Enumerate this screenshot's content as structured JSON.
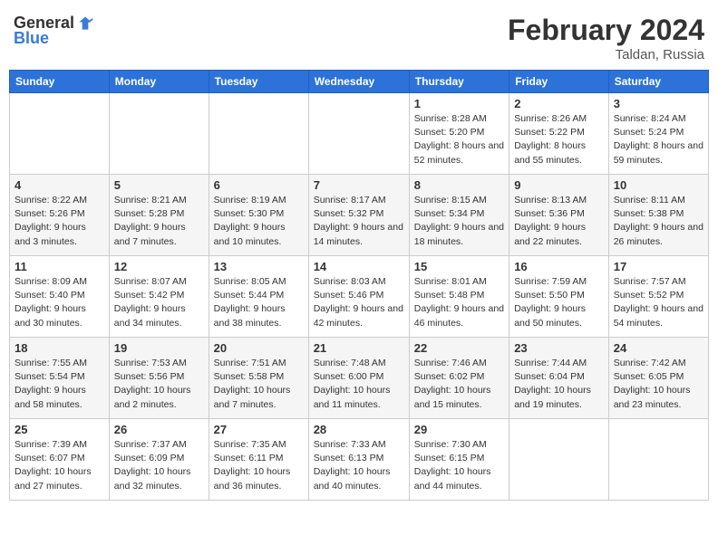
{
  "header": {
    "logo_general": "General",
    "logo_blue": "Blue",
    "month_year": "February 2024",
    "location": "Taldan, Russia"
  },
  "days_of_week": [
    "Sunday",
    "Monday",
    "Tuesday",
    "Wednesday",
    "Thursday",
    "Friday",
    "Saturday"
  ],
  "weeks": [
    [
      {
        "day": "",
        "sunrise": "",
        "sunset": "",
        "daylight": ""
      },
      {
        "day": "",
        "sunrise": "",
        "sunset": "",
        "daylight": ""
      },
      {
        "day": "",
        "sunrise": "",
        "sunset": "",
        "daylight": ""
      },
      {
        "day": "",
        "sunrise": "",
        "sunset": "",
        "daylight": ""
      },
      {
        "day": "1",
        "sunrise": "Sunrise: 8:28 AM",
        "sunset": "Sunset: 5:20 PM",
        "daylight": "Daylight: 8 hours and 52 minutes."
      },
      {
        "day": "2",
        "sunrise": "Sunrise: 8:26 AM",
        "sunset": "Sunset: 5:22 PM",
        "daylight": "Daylight: 8 hours and 55 minutes."
      },
      {
        "day": "3",
        "sunrise": "Sunrise: 8:24 AM",
        "sunset": "Sunset: 5:24 PM",
        "daylight": "Daylight: 8 hours and 59 minutes."
      }
    ],
    [
      {
        "day": "4",
        "sunrise": "Sunrise: 8:22 AM",
        "sunset": "Sunset: 5:26 PM",
        "daylight": "Daylight: 9 hours and 3 minutes."
      },
      {
        "day": "5",
        "sunrise": "Sunrise: 8:21 AM",
        "sunset": "Sunset: 5:28 PM",
        "daylight": "Daylight: 9 hours and 7 minutes."
      },
      {
        "day": "6",
        "sunrise": "Sunrise: 8:19 AM",
        "sunset": "Sunset: 5:30 PM",
        "daylight": "Daylight: 9 hours and 10 minutes."
      },
      {
        "day": "7",
        "sunrise": "Sunrise: 8:17 AM",
        "sunset": "Sunset: 5:32 PM",
        "daylight": "Daylight: 9 hours and 14 minutes."
      },
      {
        "day": "8",
        "sunrise": "Sunrise: 8:15 AM",
        "sunset": "Sunset: 5:34 PM",
        "daylight": "Daylight: 9 hours and 18 minutes."
      },
      {
        "day": "9",
        "sunrise": "Sunrise: 8:13 AM",
        "sunset": "Sunset: 5:36 PM",
        "daylight": "Daylight: 9 hours and 22 minutes."
      },
      {
        "day": "10",
        "sunrise": "Sunrise: 8:11 AM",
        "sunset": "Sunset: 5:38 PM",
        "daylight": "Daylight: 9 hours and 26 minutes."
      }
    ],
    [
      {
        "day": "11",
        "sunrise": "Sunrise: 8:09 AM",
        "sunset": "Sunset: 5:40 PM",
        "daylight": "Daylight: 9 hours and 30 minutes."
      },
      {
        "day": "12",
        "sunrise": "Sunrise: 8:07 AM",
        "sunset": "Sunset: 5:42 PM",
        "daylight": "Daylight: 9 hours and 34 minutes."
      },
      {
        "day": "13",
        "sunrise": "Sunrise: 8:05 AM",
        "sunset": "Sunset: 5:44 PM",
        "daylight": "Daylight: 9 hours and 38 minutes."
      },
      {
        "day": "14",
        "sunrise": "Sunrise: 8:03 AM",
        "sunset": "Sunset: 5:46 PM",
        "daylight": "Daylight: 9 hours and 42 minutes."
      },
      {
        "day": "15",
        "sunrise": "Sunrise: 8:01 AM",
        "sunset": "Sunset: 5:48 PM",
        "daylight": "Daylight: 9 hours and 46 minutes."
      },
      {
        "day": "16",
        "sunrise": "Sunrise: 7:59 AM",
        "sunset": "Sunset: 5:50 PM",
        "daylight": "Daylight: 9 hours and 50 minutes."
      },
      {
        "day": "17",
        "sunrise": "Sunrise: 7:57 AM",
        "sunset": "Sunset: 5:52 PM",
        "daylight": "Daylight: 9 hours and 54 minutes."
      }
    ],
    [
      {
        "day": "18",
        "sunrise": "Sunrise: 7:55 AM",
        "sunset": "Sunset: 5:54 PM",
        "daylight": "Daylight: 9 hours and 58 minutes."
      },
      {
        "day": "19",
        "sunrise": "Sunrise: 7:53 AM",
        "sunset": "Sunset: 5:56 PM",
        "daylight": "Daylight: 10 hours and 2 minutes."
      },
      {
        "day": "20",
        "sunrise": "Sunrise: 7:51 AM",
        "sunset": "Sunset: 5:58 PM",
        "daylight": "Daylight: 10 hours and 7 minutes."
      },
      {
        "day": "21",
        "sunrise": "Sunrise: 7:48 AM",
        "sunset": "Sunset: 6:00 PM",
        "daylight": "Daylight: 10 hours and 11 minutes."
      },
      {
        "day": "22",
        "sunrise": "Sunrise: 7:46 AM",
        "sunset": "Sunset: 6:02 PM",
        "daylight": "Daylight: 10 hours and 15 minutes."
      },
      {
        "day": "23",
        "sunrise": "Sunrise: 7:44 AM",
        "sunset": "Sunset: 6:04 PM",
        "daylight": "Daylight: 10 hours and 19 minutes."
      },
      {
        "day": "24",
        "sunrise": "Sunrise: 7:42 AM",
        "sunset": "Sunset: 6:05 PM",
        "daylight": "Daylight: 10 hours and 23 minutes."
      }
    ],
    [
      {
        "day": "25",
        "sunrise": "Sunrise: 7:39 AM",
        "sunset": "Sunset: 6:07 PM",
        "daylight": "Daylight: 10 hours and 27 minutes."
      },
      {
        "day": "26",
        "sunrise": "Sunrise: 7:37 AM",
        "sunset": "Sunset: 6:09 PM",
        "daylight": "Daylight: 10 hours and 32 minutes."
      },
      {
        "day": "27",
        "sunrise": "Sunrise: 7:35 AM",
        "sunset": "Sunset: 6:11 PM",
        "daylight": "Daylight: 10 hours and 36 minutes."
      },
      {
        "day": "28",
        "sunrise": "Sunrise: 7:33 AM",
        "sunset": "Sunset: 6:13 PM",
        "daylight": "Daylight: 10 hours and 40 minutes."
      },
      {
        "day": "29",
        "sunrise": "Sunrise: 7:30 AM",
        "sunset": "Sunset: 6:15 PM",
        "daylight": "Daylight: 10 hours and 44 minutes."
      },
      {
        "day": "",
        "sunrise": "",
        "sunset": "",
        "daylight": ""
      },
      {
        "day": "",
        "sunrise": "",
        "sunset": "",
        "daylight": ""
      }
    ]
  ]
}
